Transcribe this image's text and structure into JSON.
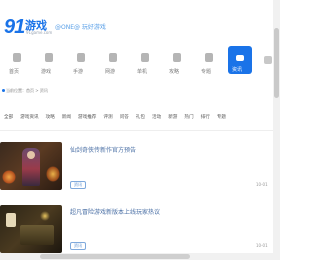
{
  "header": {
    "logo_number": "91",
    "logo_text": "游戏",
    "logo_sub": "91game.com",
    "slogan": "@ONE@  玩好游戏"
  },
  "nav": {
    "items": [
      {
        "label": "首页",
        "icon": "home-icon",
        "active": false
      },
      {
        "label": "游戏",
        "icon": "gamepad-icon",
        "active": false
      },
      {
        "label": "手游",
        "icon": "phone-icon",
        "active": false
      },
      {
        "label": "网游",
        "icon": "apple-icon",
        "active": false
      },
      {
        "label": "单机",
        "icon": "android-icon",
        "active": false
      },
      {
        "label": "攻略",
        "icon": "book-icon",
        "active": false
      },
      {
        "label": "专题",
        "icon": "doc-icon",
        "active": false
      },
      {
        "label": "资讯",
        "icon": "news-icon",
        "active": true
      }
    ]
  },
  "breadcrumb": "当前位置：首页 > 资讯",
  "tags": [
    "全部",
    "游戏资讯",
    "攻略",
    "新闻",
    "游戏推荐",
    "评测",
    "问答",
    "礼包",
    "活动",
    "新游",
    "热门",
    "排行",
    "专题"
  ],
  "articles": [
    {
      "title": "仙剑奇侠传新作官方预告",
      "tag": "资讯",
      "date": "10-01"
    },
    {
      "title": "超凡冒险游戏新版本上线玩家热议",
      "tag": "资讯",
      "date": "10-01"
    }
  ],
  "colors": {
    "accent": "#1a73e8",
    "link": "#4a6fa5"
  }
}
